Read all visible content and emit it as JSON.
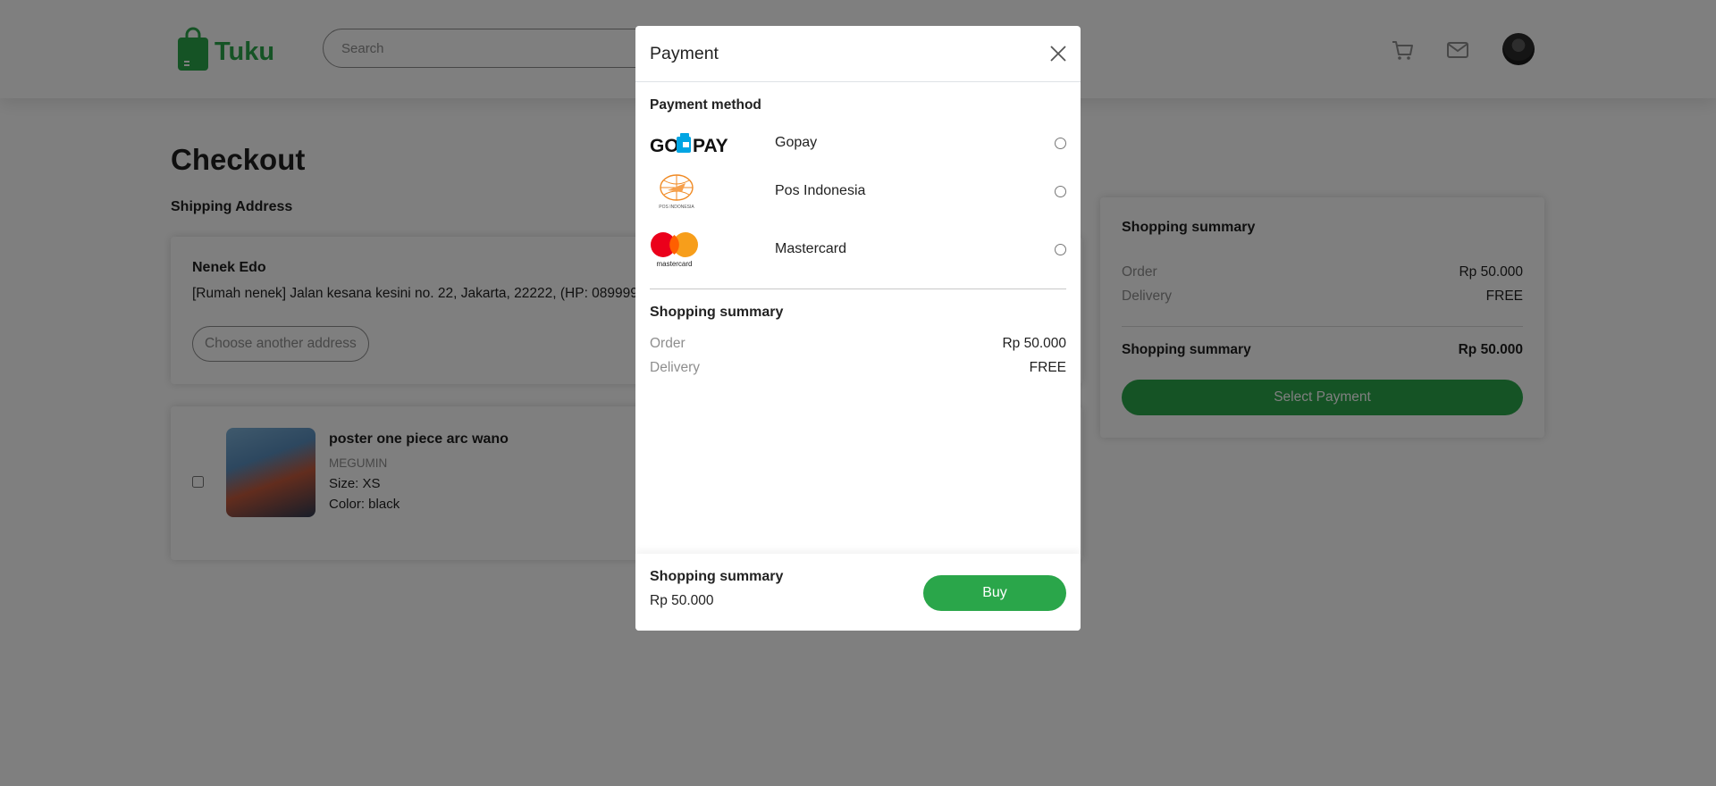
{
  "app": {
    "name": "Tuku",
    "brand_color": "#2aa64a"
  },
  "navbar": {
    "search_placeholder": "Search",
    "icons": [
      "cart-icon",
      "mail-icon",
      "user-avatar"
    ]
  },
  "checkout": {
    "title": "Checkout",
    "shipping_label": "Shipping Address",
    "address": {
      "name": "Nenek Edo",
      "text": "[Rumah nenek] Jalan kesana kesini no. 22, Jakarta, 22222, (HP: 0899999",
      "change_button": "Choose another address"
    },
    "item": {
      "name": "poster one piece arc wano",
      "store": "MEGUMIN",
      "size": "Size: XS",
      "color": "Color: black",
      "checked": false
    }
  },
  "summary": {
    "title": "Shopping summary",
    "order_label": "Order",
    "order_value": "Rp 50.000",
    "delivery_label": "Delivery",
    "delivery_value": "FREE",
    "total_label": "Shopping summary",
    "total_value": "Rp 50.000",
    "button": "Select Payment"
  },
  "modal": {
    "title": "Payment",
    "method_label": "Payment method",
    "methods": [
      {
        "name": "Gopay",
        "logo": "gopay-logo",
        "selected": false
      },
      {
        "name": "Pos Indonesia",
        "logo": "pos-indonesia-logo",
        "logo_caption": "POS INDONESIA",
        "selected": false
      },
      {
        "name": "Mastercard",
        "logo": "mastercard-logo",
        "logo_caption": "mastercard",
        "selected": false
      }
    ],
    "summary": {
      "title": "Shopping summary",
      "order_label": "Order",
      "order_value": "Rp 50.000",
      "delivery_label": "Delivery",
      "delivery_value": "FREE"
    },
    "footer": {
      "title": "Shopping summary",
      "price": "Rp 50.000",
      "buy_button": "Buy"
    }
  }
}
